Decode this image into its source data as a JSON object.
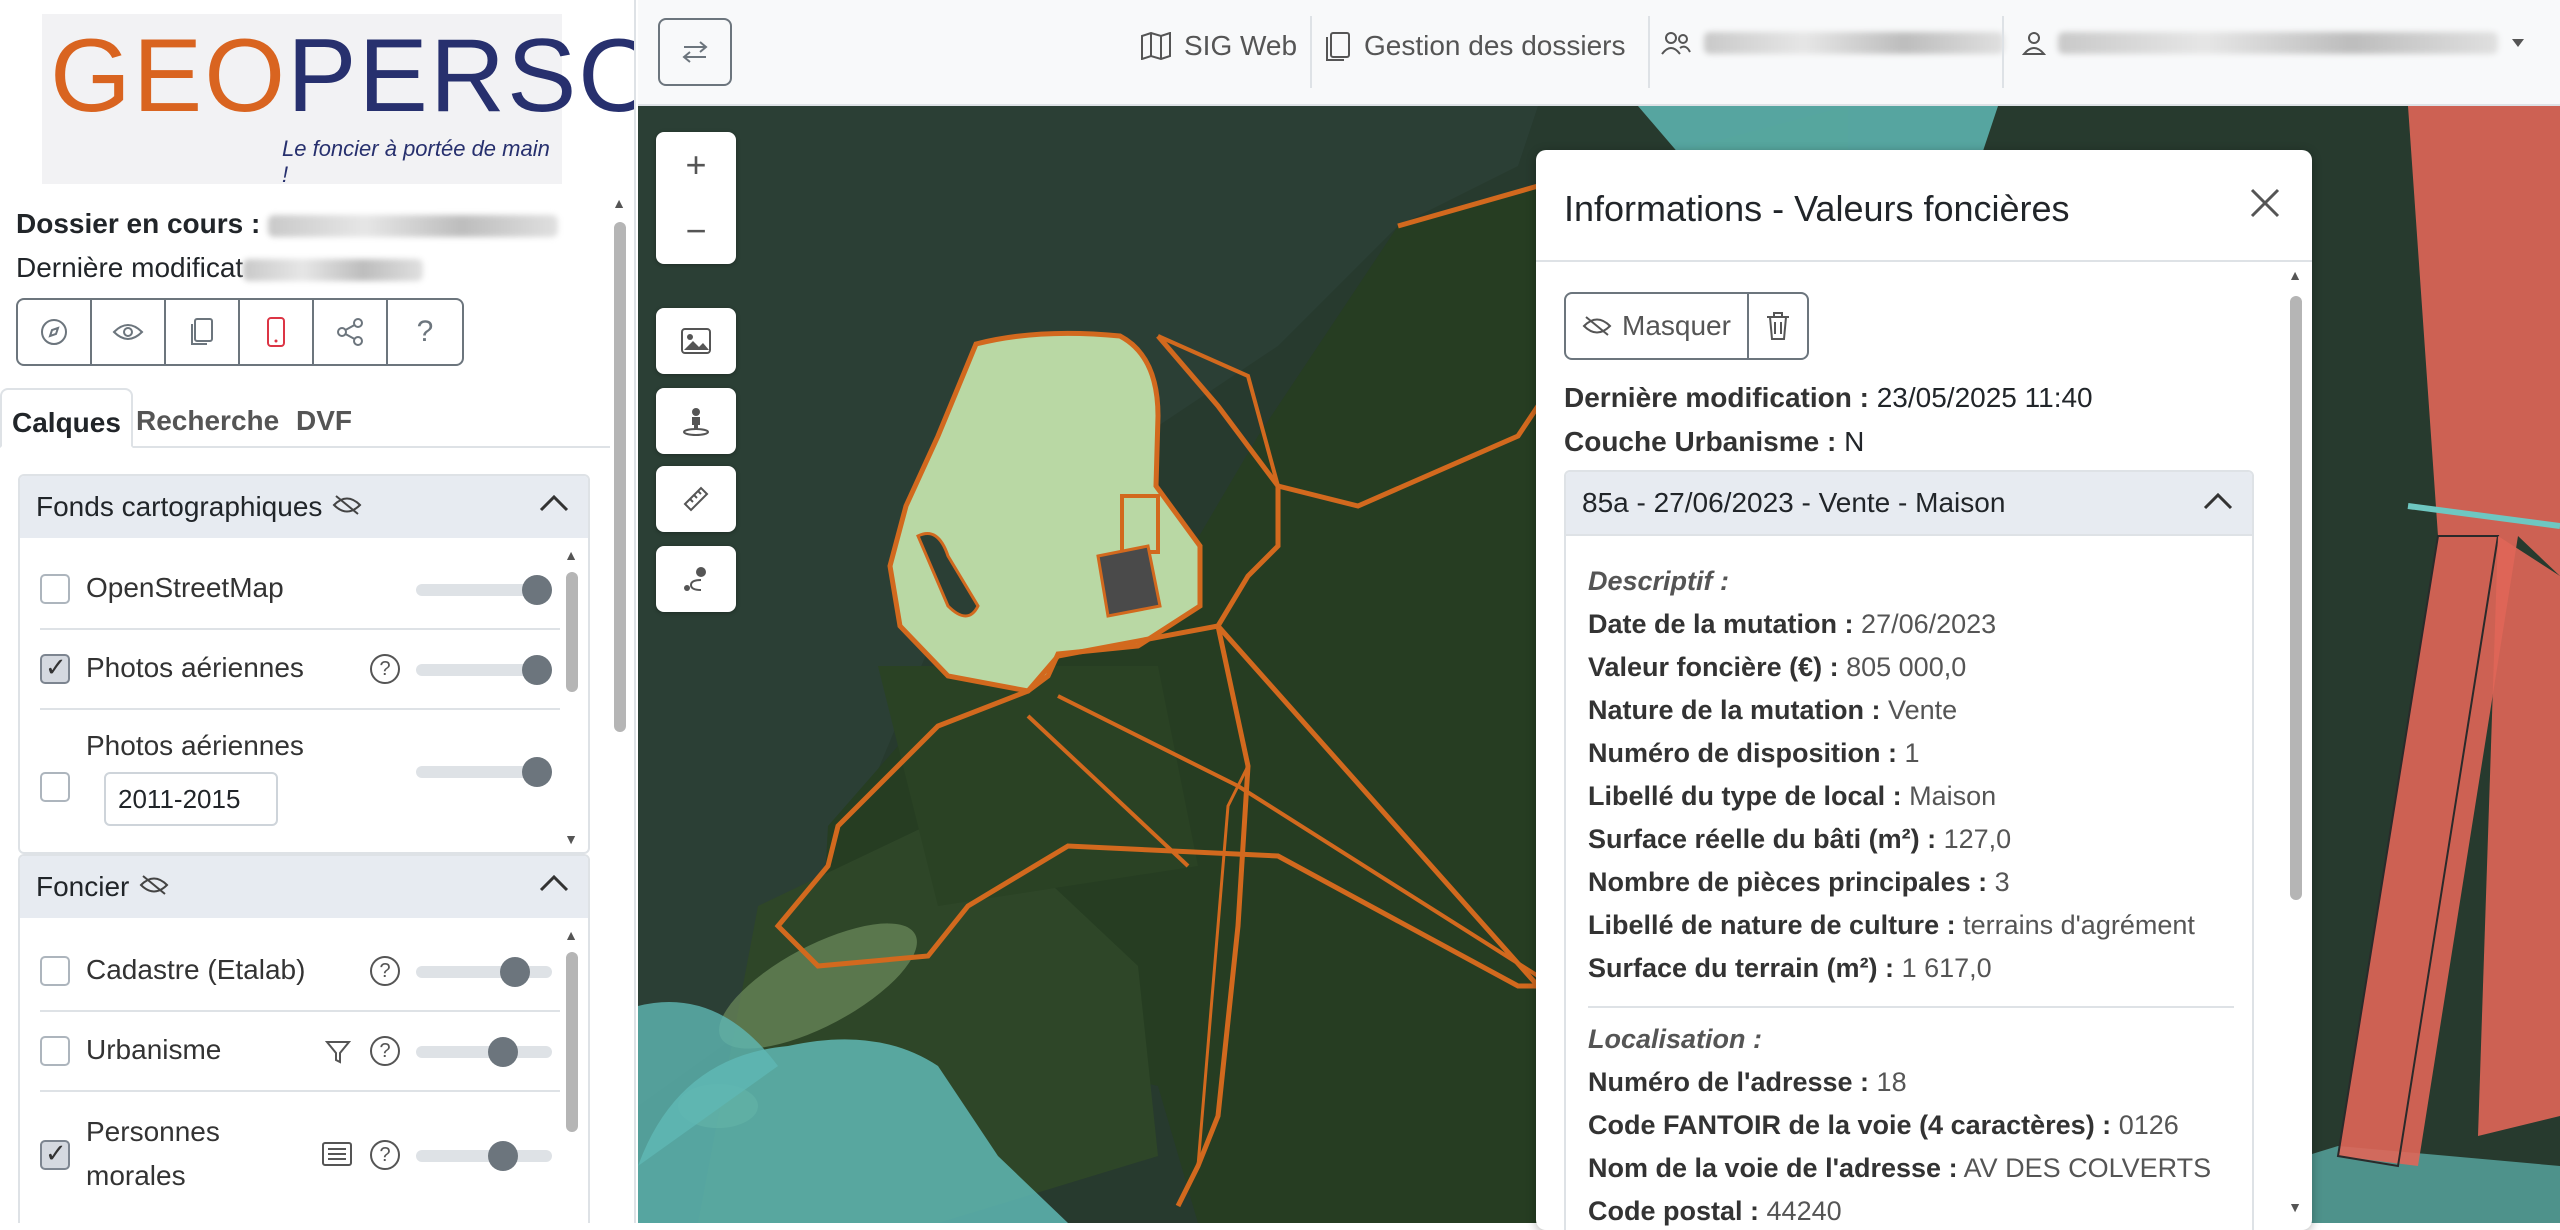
{
  "logo": {
    "geo": "GEO",
    "perso": "PERSO",
    "tagline": "Le foncier à portée de main !"
  },
  "dossier": {
    "current_label": "Dossier en cours :",
    "last_modified_label": "Dernière modificat"
  },
  "tabs": [
    "Calques",
    "Recherche",
    "DVF"
  ],
  "basemaps": {
    "title": "Fonds cartographiques",
    "items": [
      {
        "label": "OpenStreetMap",
        "checked": false,
        "opacity": 1.0
      },
      {
        "label": "Photos aériennes",
        "checked": true,
        "opacity": 1.0
      },
      {
        "label": "Photos aériennes",
        "checked": false,
        "opacity": 1.0,
        "select_value": "2011-2015"
      }
    ]
  },
  "foncier": {
    "title": "Foncier",
    "items": [
      {
        "label": "Cadastre (Etalab)",
        "checked": false,
        "opacity": 0.8
      },
      {
        "label": "Urbanisme",
        "checked": false,
        "opacity": 0.7
      },
      {
        "label_line1": "Personnes",
        "label_line2": "morales",
        "checked": true,
        "opacity": 0.7
      }
    ]
  },
  "topbar": {
    "sig_web": "SIG Web",
    "gestion": "Gestion des dossiers"
  },
  "panel": {
    "title": "Informations - Valeurs foncières",
    "hide_button": "Masquer",
    "last_mod_label": "Dernière modification :",
    "last_mod_value": "23/05/2025 11:40",
    "urba_label": "Couche Urbanisme :",
    "urba_value": "N",
    "accordion_title": "85a - 27/06/2023 - Vente - Maison",
    "descriptif_title": "Descriptif :",
    "descriptif": [
      {
        "label": "Date de la mutation :",
        "value": "27/06/2023"
      },
      {
        "label": "Valeur foncière (€) :",
        "value": "805 000,0"
      },
      {
        "label": "Nature de la mutation :",
        "value": "Vente"
      },
      {
        "label": "Numéro de disposition :",
        "value": "1"
      },
      {
        "label": "Libellé du type de local :",
        "value": "Maison"
      },
      {
        "label": "Surface réelle du bâti (m²) :",
        "value": "127,0"
      },
      {
        "label": "Nombre de pièces principales :",
        "value": "3"
      },
      {
        "label": "Libellé de nature de culture :",
        "value": "terrains d'agrément"
      },
      {
        "label": "Surface du terrain (m²) :",
        "value": "1 617,0"
      }
    ],
    "localisation_title": "Localisation :",
    "localisation": [
      {
        "label": "Numéro de l'adresse :",
        "value": "18"
      },
      {
        "label": "Code FANTOIR de la voie (4 caractères) :",
        "value": "0126"
      },
      {
        "label": "Nom de la voie de l'adresse :",
        "value": "AV DES COLVERTS"
      },
      {
        "label": "Code postal :",
        "value": "44240"
      }
    ]
  },
  "colors": {
    "accent": "#d96420",
    "brand": "#27306e",
    "parcel_outline": "#d2691e",
    "water": "#5fb8b4",
    "red_zone": "#e06658"
  }
}
